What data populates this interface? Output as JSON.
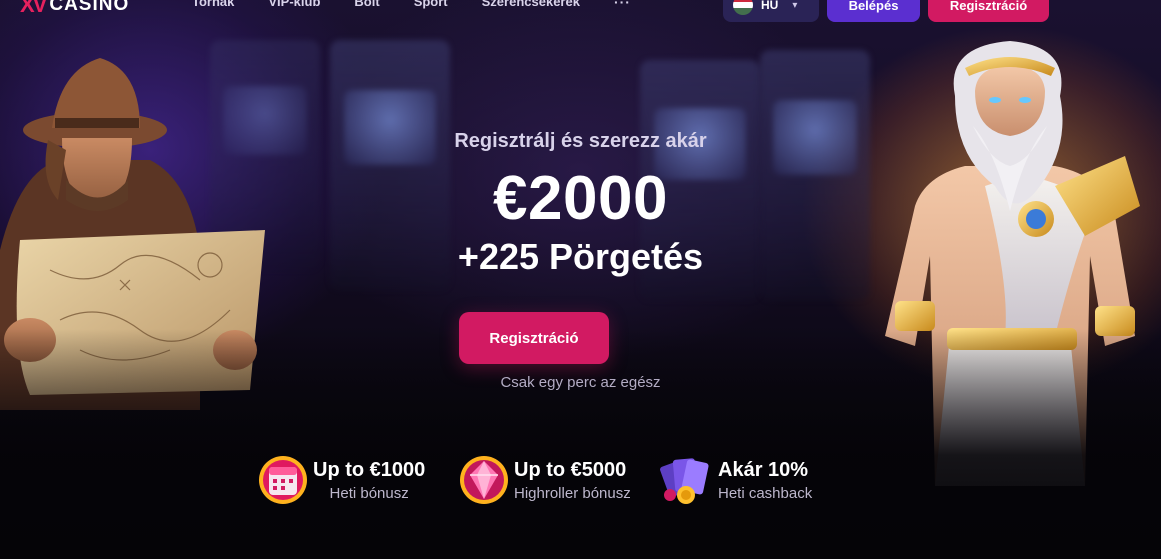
{
  "nav": {
    "logo_mark": "XV",
    "logo_text": "CASINO",
    "links": [
      "Tornák",
      "VIP-klub",
      "Bolt",
      "Sport",
      "Szerencsekerék"
    ],
    "more": "···",
    "language": "HU",
    "login_label": "Belépés",
    "register_label": "Regisztráció"
  },
  "hero": {
    "subtitle": "Regisztrálj és szerezz akár",
    "amount": "€2000",
    "spins": "+225 Pörgetés",
    "cta_label": "Regisztráció",
    "cta_note": "Csak egy perc az egész"
  },
  "perks": [
    {
      "icon": "calendar-icon",
      "title": "Up to €1000",
      "subtitle": "Heti bónusz"
    },
    {
      "icon": "gem-icon",
      "title": "Up to €5000",
      "subtitle": "Highroller bónusz"
    },
    {
      "icon": "cards-cashback-icon",
      "title": "Akár 10%",
      "subtitle": "Heti cashback"
    }
  ],
  "colors": {
    "brand_pink": "#d21a62",
    "login_purple": "#5b2fd0",
    "lang_bg": "#2a2356"
  }
}
